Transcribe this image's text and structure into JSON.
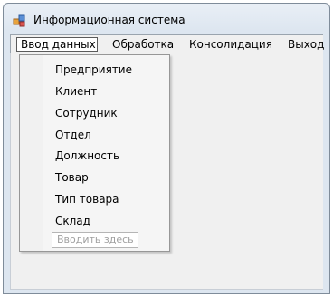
{
  "window": {
    "title": "Информационная система",
    "icon": "app-form-icon"
  },
  "menubar": {
    "items": [
      {
        "label": "Ввод данных"
      },
      {
        "label": "Обработка"
      },
      {
        "label": "Консолидация"
      },
      {
        "label": "Выход"
      }
    ]
  },
  "dropdown": {
    "items": [
      {
        "label": "Предприятие"
      },
      {
        "label": "Клиент"
      },
      {
        "label": "Сотрудник"
      },
      {
        "label": "Отдел"
      },
      {
        "label": "Должность"
      },
      {
        "label": "Товар"
      },
      {
        "label": "Тип товара"
      },
      {
        "label": "Склад"
      }
    ],
    "type_here": "Вводить здесь"
  },
  "colors": {
    "window_bg": "#dde6f0",
    "menu_bg": "#f0f0f0",
    "placeholder_text": "#a0a0a0"
  }
}
